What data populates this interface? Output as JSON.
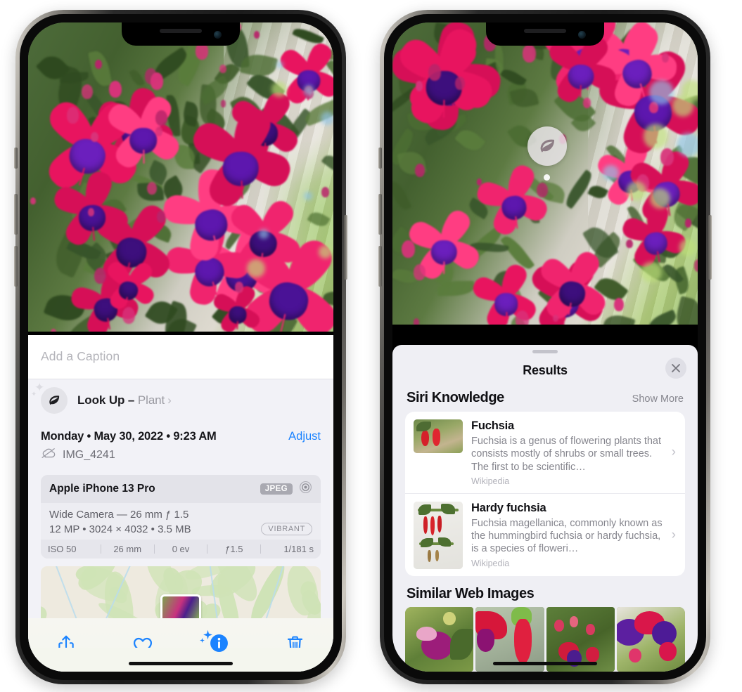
{
  "left_phone": {
    "caption": {
      "placeholder": "Add a Caption",
      "value": ""
    },
    "lookup": {
      "label": "Look Up",
      "dash": "–",
      "subject": "Plant",
      "icon": "leaf-icon",
      "chevron": "›"
    },
    "meta": {
      "date": "Monday • May 30, 2022 • 9:23 AM",
      "adjust": "Adjust",
      "filename": "IMG_4241",
      "cloud_icon": "icloud-slash-icon"
    },
    "exif": {
      "device": "Apple iPhone 13 Pro",
      "format_badge": "JPEG",
      "info_icon": "aperture-icon",
      "lens": "Wide Camera — 26 mm ƒ 1.5",
      "specs": "12 MP  •  3024 × 4032  •  3.5 MB",
      "style_badge": "VIBRANT",
      "settings": [
        "ISO 50",
        "26 mm",
        "0 ev",
        "ƒ1.5",
        "1/181 s"
      ]
    },
    "toolbar": [
      {
        "name": "share-icon",
        "label": "Share"
      },
      {
        "name": "heart-icon",
        "label": "Favorite"
      },
      {
        "name": "info-sparkle-icon",
        "label": "Info"
      },
      {
        "name": "trash-icon",
        "label": "Delete"
      }
    ]
  },
  "right_phone": {
    "photo_badge": {
      "icon": "leaf-icon",
      "label": "Visual Look Up"
    },
    "sheet": {
      "title": "Results",
      "close_icon": "close-icon",
      "grabber": "drag-handle"
    },
    "siri_knowledge": {
      "heading": "Siri Knowledge",
      "show_more": "Show More",
      "items": [
        {
          "title": "Fuchsia",
          "description": "Fuchsia is a genus of flowering plants that consists mostly of shrubs or small trees. The first to be scientific…",
          "source": "Wikipedia",
          "chevron": "›"
        },
        {
          "title": "Hardy fuchsia",
          "description": "Fuchsia magellanica, commonly known as the hummingbird fuchsia or hardy fuchsia, is a species of floweri…",
          "source": "Wikipedia",
          "chevron": "›"
        }
      ]
    },
    "similar_web_images": {
      "heading": "Similar Web Images",
      "thumbnails": [
        "fuchsia-thumb-1",
        "fuchsia-thumb-2",
        "fuchsia-thumb-3",
        "fuchsia-thumb-4"
      ]
    }
  },
  "colors": {
    "accent_blue": "#1b83ff",
    "sheet_bg": "#efeff4",
    "card_bg": "#ffffff",
    "secondary_text": "#86868e",
    "primary_text": "#101014"
  }
}
